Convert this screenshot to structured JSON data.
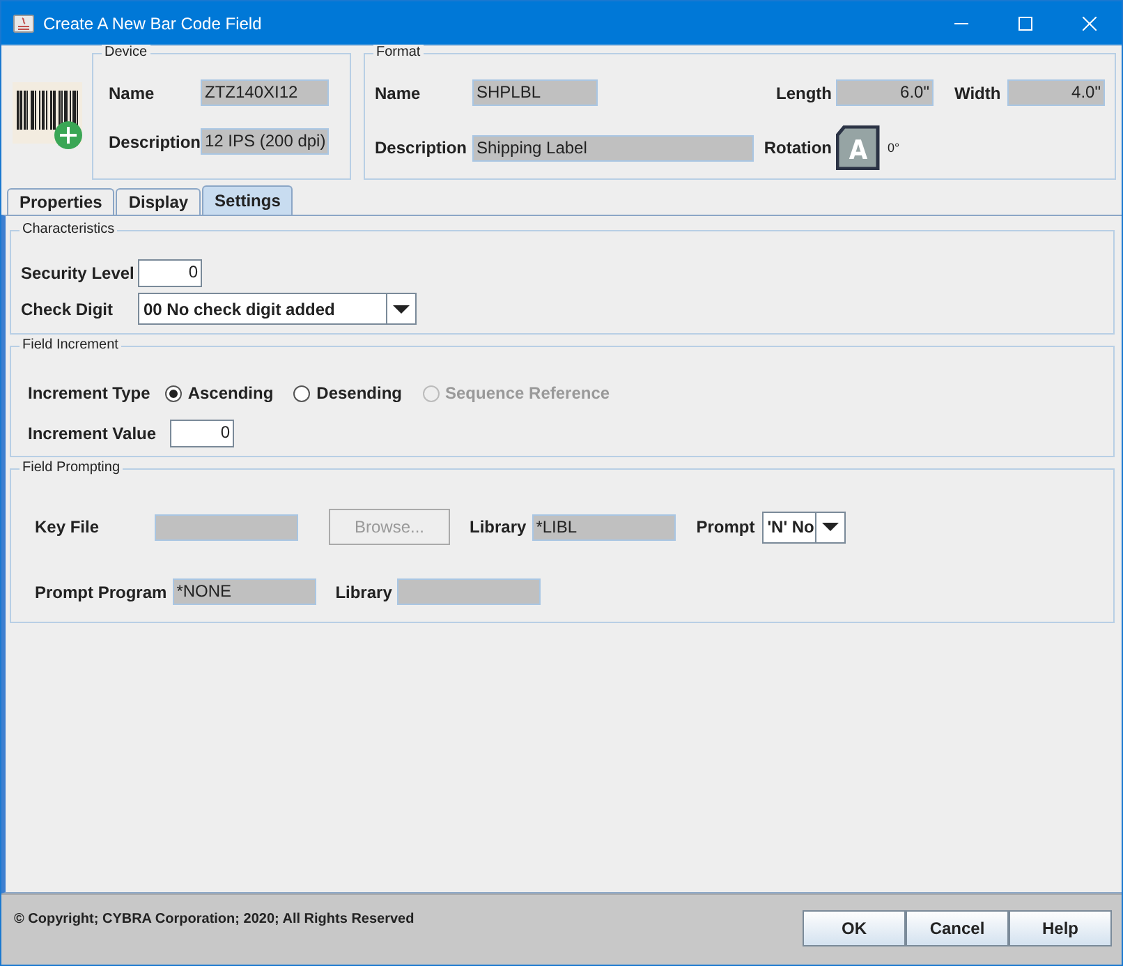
{
  "window": {
    "title": "Create A New Bar Code Field"
  },
  "device": {
    "legend": "Device",
    "fields": [
      {
        "label": "Name",
        "value": "ZTZ140XI12"
      },
      {
        "label": "Description",
        "value": "12 IPS (200 dpi)"
      }
    ]
  },
  "format": {
    "legend": "Format",
    "name_label": "Name",
    "name_value": "SHPLBL",
    "description_label": "Description",
    "description_value": "Shipping Label",
    "length_label": "Length",
    "length_value": "6.0\"",
    "width_label": "Width",
    "width_value": "4.0\"",
    "rotation_label": "Rotation",
    "rotation_glyph": "A",
    "rotation_value": "0°"
  },
  "tabs": [
    {
      "label": "Properties",
      "selected": false
    },
    {
      "label": "Display",
      "selected": false
    },
    {
      "label": "Settings",
      "selected": true
    }
  ],
  "characteristics": {
    "legend": "Characteristics",
    "security_label": "Security Level",
    "security_value": "0",
    "check_label": "Check Digit",
    "check_value": "00 No check digit added"
  },
  "field_increment": {
    "legend": "Field Increment",
    "type_label": "Increment Type",
    "options": [
      {
        "label": "Ascending",
        "selected": true,
        "disabled": false
      },
      {
        "label": "Desending",
        "selected": false,
        "disabled": false
      },
      {
        "label": "Sequence Reference",
        "selected": false,
        "disabled": true
      }
    ],
    "value_label": "Increment Value",
    "value": "0"
  },
  "field_prompting": {
    "legend": "Field Prompting",
    "key_file_label": "Key File",
    "browse": {
      "label": "Browse...",
      "disabled": true
    },
    "library_label": "Library",
    "library_value": "*LIBL",
    "prompt_label": "Prompt",
    "prompt_value": "'N' No",
    "program_label": "Prompt Program",
    "program_value": "*NONE",
    "library2_label": "Library"
  },
  "footer": {
    "copyright": "© Copyright; CYBRA Corporation; 2020; All Rights Reserved",
    "buttons": [
      "OK",
      "Cancel",
      "Help"
    ]
  }
}
